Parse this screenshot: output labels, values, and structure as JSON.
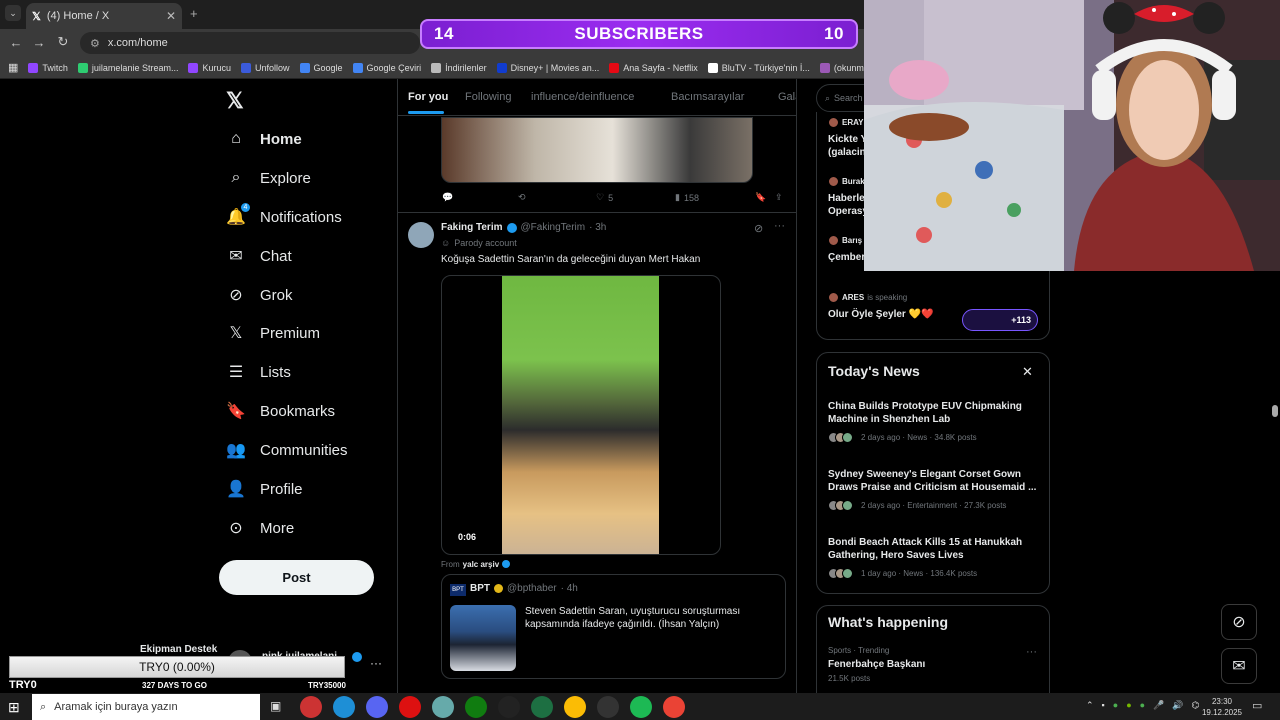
{
  "browser": {
    "tab_title": "(4) Home / X",
    "url": "x.com/home",
    "bookmarks": [
      "Twitch",
      "juilamelanie Stream...",
      "Kurucu",
      "Unfollow",
      "Google",
      "Google Çeviri",
      "İndirilenler",
      "Disney+ | Movies an...",
      "Ana Sayfa - Netflix",
      "BluTV - Türkiye'nin İ...",
      "(okunmamış sayısı)..."
    ],
    "bookmark_colors": [
      "#9146ff",
      "#2ecc71",
      "#9146ff",
      "#3b5bdb",
      "#4285f4",
      "#4285f4",
      "#bbbbbb",
      "#113ccf",
      "#e50914",
      "#ffffff",
      "#9b59b6"
    ]
  },
  "banner": {
    "left": "14",
    "text": "SUBSCRIBERS",
    "right": "10"
  },
  "nav": {
    "items": [
      {
        "label": "Home",
        "icon": "home-icon"
      },
      {
        "label": "Explore",
        "icon": "search-icon"
      },
      {
        "label": "Notifications",
        "icon": "bell-icon",
        "badge": "4"
      },
      {
        "label": "Chat",
        "icon": "mail-icon"
      },
      {
        "label": "Grok",
        "icon": "grok-icon"
      },
      {
        "label": "Premium",
        "icon": "x-icon"
      },
      {
        "label": "Lists",
        "icon": "list-icon"
      },
      {
        "label": "Bookmarks",
        "icon": "bookmark-icon"
      },
      {
        "label": "Communities",
        "icon": "people-icon"
      },
      {
        "label": "Profile",
        "icon": "person-icon"
      },
      {
        "label": "More",
        "icon": "more-icon"
      }
    ],
    "post_label": "Post",
    "account_name": "pink juilamelani",
    "support_label": "Ekipman Destek"
  },
  "timeline": {
    "tabs": [
      "For you",
      "Following",
      "influence/deinfluence",
      "Bacımsarayılar",
      "Gala"
    ],
    "prev_tweet": {
      "replies": "",
      "retweets": "",
      "likes": "5",
      "views": "158"
    },
    "tweet": {
      "name": "Faking Terim",
      "handle": "@FakingTerim",
      "time": "· 3h",
      "parody": "Parody account",
      "text": "Koğuşa Sadettin Saran'ın da geleceğini duyan Mert Hakan",
      "video_time": "0:06",
      "from_label": "From",
      "from_account": "yalc arşiv",
      "quote": {
        "name": "BPT",
        "handle": "@bpthaber",
        "time": "· 4h",
        "text": "Steven Sadettin Saran, uyuşturucu soruşturması kapsamında ifadeye çağırıldı. (İhsan Yalçın)"
      }
    }
  },
  "right": {
    "search_placeholder": "Search",
    "spaces": [
      {
        "host": "ERAY",
        "title": "Kickte Y",
        "sub": "(galacin"
      },
      {
        "host": "Burak",
        "title": "Haberle",
        "sub": "Operasy"
      },
      {
        "host": "Barış",
        "title": "Çember",
        "sub": ""
      },
      {
        "host": "ARES",
        "status": "is speaking",
        "title": "Olur Öyle Şeyler 💛❤️",
        "listeners": "+113"
      }
    ],
    "news_heading": "Today's News",
    "news": [
      {
        "title": "China Builds Prototype EUV Chipmaking Machine in Shenzhen Lab",
        "meta": "2 days ago · News · 34.8K posts"
      },
      {
        "title": "Sydney Sweeney's Elegant Corset Gown Draws Praise and Criticism at Housemaid ...",
        "meta": "2 days ago · Entertainment · 27.3K posts"
      },
      {
        "title": "Bondi Beach Attack Kills 15 at Hanukkah Gathering, Hero Saves Lives",
        "meta": "1 day ago · News · 136.4K posts"
      }
    ],
    "happening_heading": "What's happening",
    "trend": {
      "category": "Sports · Trending",
      "title": "Fenerbahçe Başkanı",
      "posts": "21.5K posts"
    }
  },
  "overlay": {
    "goal": "TRY0 (0.00%)",
    "left": "TRY0",
    "days": "327 DAYS TO GO",
    "target": "TRY35000"
  },
  "taskbar": {
    "search_placeholder": "Aramak için buraya yazın",
    "time": "23:30",
    "date": "19.12.2025"
  },
  "colors": {
    "accent": "#1d9bf0",
    "banner": "#9b2cf0",
    "verified": "#1d9bf0",
    "gold_verified": "#e2b719"
  }
}
